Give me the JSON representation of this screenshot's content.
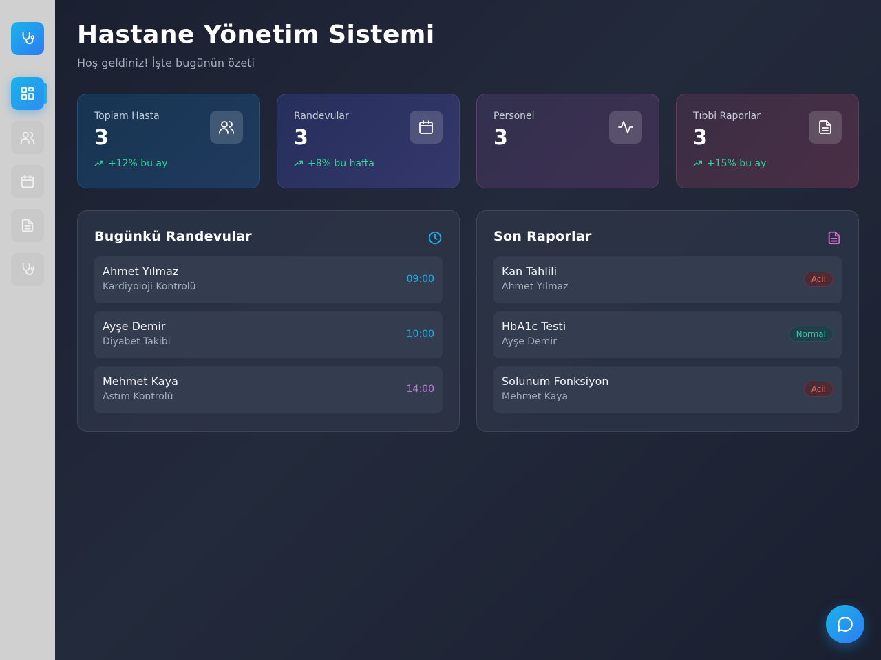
{
  "header": {
    "title": "Hastane Yönetim Sistemi",
    "subtitle": "Hoş geldiniz! İşte bugünün özeti"
  },
  "sidebar": {
    "items": [
      {
        "icon": "stethoscope-icon",
        "state": "logo"
      },
      {
        "icon": "dashboard-icon",
        "state": "active"
      },
      {
        "icon": "users-icon",
        "state": "muted"
      },
      {
        "icon": "calendar-icon",
        "state": "muted"
      },
      {
        "icon": "document-icon",
        "state": "muted"
      },
      {
        "icon": "stethoscope-icon",
        "state": "muted"
      }
    ]
  },
  "stats": [
    {
      "label": "Toplam Hasta",
      "value": "3",
      "trend": "+12% bu ay",
      "icon": "users-icon"
    },
    {
      "label": "Randevular",
      "value": "3",
      "trend": "+8% bu hafta",
      "icon": "calendar-icon"
    },
    {
      "label": "Personel",
      "value": "3",
      "trend": "",
      "icon": "activity-icon"
    },
    {
      "label": "Tıbbi Raporlar",
      "value": "3",
      "trend": "+15% bu ay",
      "icon": "document-icon"
    }
  ],
  "appointments": {
    "title": "Bugünkü Randevular",
    "icon": "clock-icon",
    "items": [
      {
        "name": "Ahmet Yılmaz",
        "detail": "Kardiyoloji Kontrolü",
        "time": "09:00",
        "color": "#1ab3e8"
      },
      {
        "name": "Ayşe Demir",
        "detail": "Diyabet Takibi",
        "time": "10:00",
        "color": "#1ab3e8"
      },
      {
        "name": "Mehmet Kaya",
        "detail": "Astım Kontrolü",
        "time": "14:00",
        "color": "#c77dd8"
      }
    ]
  },
  "reports": {
    "title": "Son Raporlar",
    "icon": "document-icon",
    "items": [
      {
        "name": "Kan Tahlili",
        "patient": "Ahmet Yılmaz",
        "status": "Acil"
      },
      {
        "name": "HbA1c Testi",
        "patient": "Ayşe Demir",
        "status": "Normal"
      },
      {
        "name": "Solunum Fonksiyon",
        "patient": "Mehmet Kaya",
        "status": "Acil"
      }
    ]
  },
  "colors": {
    "accent": "#1ab3e8",
    "trend": "#34d39a",
    "urgent": "#ef6a4a",
    "normal": "#34c6a6"
  },
  "chat": {
    "icon": "chat-icon"
  }
}
